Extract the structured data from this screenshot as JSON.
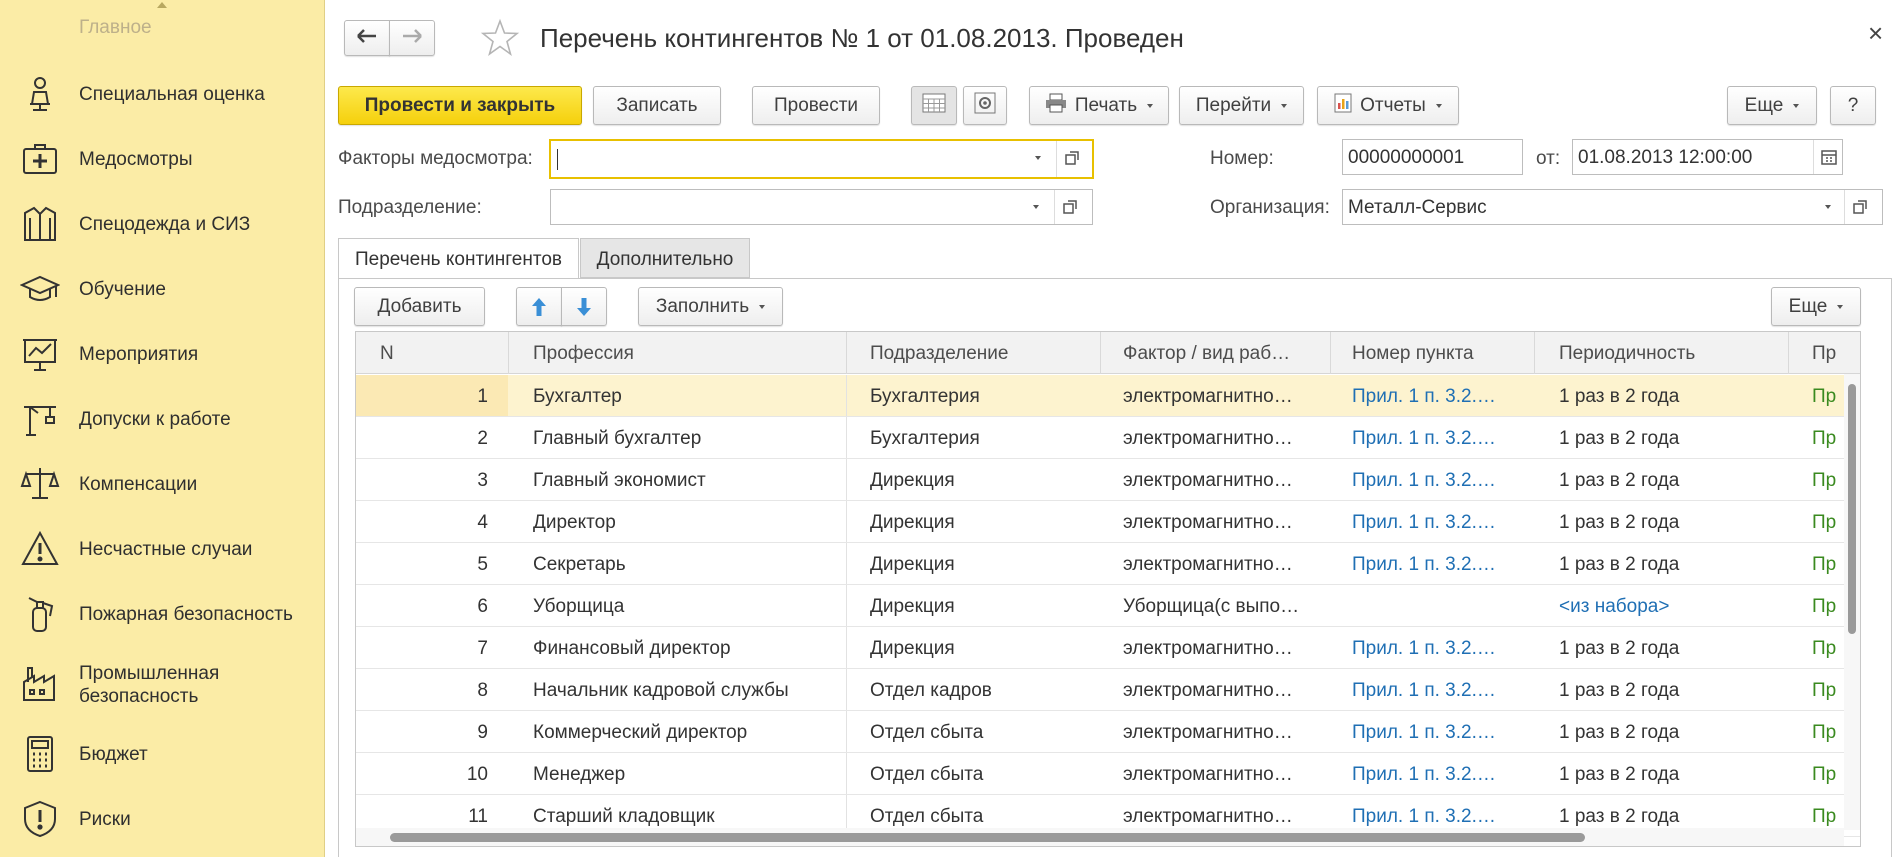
{
  "sidebar": {
    "top_cut_label": "Главное",
    "items": [
      {
        "label": "Специальная оценка",
        "icon": "worker-chair-icon"
      },
      {
        "label": "Медосмотры",
        "icon": "medical-case-icon"
      },
      {
        "label": "Спецодежда и СИЗ",
        "icon": "jacket-icon"
      },
      {
        "label": "Обучение",
        "icon": "graduation-cap-icon"
      },
      {
        "label": "Мероприятия",
        "icon": "presentation-board-icon"
      },
      {
        "label": "Допуски к работе",
        "icon": "crane-icon"
      },
      {
        "label": "Компенсации",
        "icon": "scales-icon"
      },
      {
        "label": "Несчастные случаи",
        "icon": "warning-triangle-icon"
      },
      {
        "label": "Пожарная безопасность",
        "icon": "fire-extinguisher-icon"
      },
      {
        "label": "Промышленная безопасность",
        "icon": "factory-icon"
      },
      {
        "label": "Бюджет",
        "icon": "calculator-icon"
      },
      {
        "label": "Риски",
        "icon": "exclamation-shield-icon"
      }
    ]
  },
  "window": {
    "title": "Перечень контингентов № 1 от 01.08.2013. Проведен",
    "close_glyph": "×"
  },
  "toolbar": {
    "post_close": "Провести и закрыть",
    "save": "Записать",
    "post": "Провести",
    "print": "Печать",
    "goto": "Перейти",
    "reports": "Отчеты",
    "more": "Еще",
    "help": "?"
  },
  "form": {
    "factors_label": "Факторы медосмотра:",
    "factors_value": "",
    "department_label": "Подразделение:",
    "department_value": "",
    "number_label": "Номер:",
    "number_value": "00000000001",
    "date_label": "от:",
    "date_value": "01.08.2013 12:00:00",
    "org_label": "Организация:",
    "org_value": "Металл-Сервис"
  },
  "tabs": [
    "Перечень контингентов",
    "Дополнительно"
  ],
  "table_toolbar": {
    "add": "Добавить",
    "fill": "Заполнить",
    "more": "Еще"
  },
  "table": {
    "columns": [
      "N",
      "Профессия",
      "Подразделение",
      "Фактор / вид раб…",
      "Номер пункта",
      "Периодичность",
      "Пр"
    ],
    "rows": [
      {
        "n": "1",
        "prof": "Бухгалтер",
        "dep": "Бухгалтерия",
        "factor": "электромагнитно…",
        "point": "Прил. 1 п. 3.2.…",
        "period": "1 раз в 2 года",
        "extra": "Пр"
      },
      {
        "n": "2",
        "prof": "Главный бухгалтер",
        "dep": "Бухгалтерия",
        "factor": "электромагнитно…",
        "point": "Прил. 1 п. 3.2.…",
        "period": "1 раз в 2 года",
        "extra": "Пр"
      },
      {
        "n": "3",
        "prof": "Главный экономист",
        "dep": "Дирекция",
        "factor": "электромагнитно…",
        "point": "Прил. 1 п. 3.2.…",
        "period": "1 раз в 2 года",
        "extra": "Пр"
      },
      {
        "n": "4",
        "prof": "Директор",
        "dep": "Дирекция",
        "factor": "электромагнитно…",
        "point": "Прил. 1 п. 3.2.…",
        "period": "1 раз в 2 года",
        "extra": "Пр"
      },
      {
        "n": "5",
        "prof": "Секретарь",
        "dep": "Дирекция",
        "factor": "электромагнитно…",
        "point": "Прил. 1 п. 3.2.…",
        "period": "1 раз в 2 года",
        "extra": "Пр"
      },
      {
        "n": "6",
        "prof": "Уборщица",
        "dep": "Дирекция",
        "factor": "Уборщица(с выпо…",
        "point": "",
        "period": "<из набора>",
        "extra": "Пр"
      },
      {
        "n": "7",
        "prof": "Финансовый директор",
        "dep": "Дирекция",
        "factor": "электромагнитно…",
        "point": "Прил. 1 п. 3.2.…",
        "period": "1 раз в 2 года",
        "extra": "Пр"
      },
      {
        "n": "8",
        "prof": "Начальник кадровой службы",
        "dep": "Отдел кадров",
        "factor": "электромагнитно…",
        "point": "Прил. 1 п. 3.2.…",
        "period": "1 раз в 2 года",
        "extra": "Пр"
      },
      {
        "n": "9",
        "prof": "Коммерческий директор",
        "dep": "Отдел сбыта",
        "factor": "электромагнитно…",
        "point": "Прил. 1 п. 3.2.…",
        "period": "1 раз в 2 года",
        "extra": "Пр"
      },
      {
        "n": "10",
        "prof": "Менеджер",
        "dep": "Отдел сбыта",
        "factor": "электромагнитно…",
        "point": "Прил. 1 п. 3.2.…",
        "period": "1 раз в 2 года",
        "extra": "Пр"
      },
      {
        "n": "11",
        "prof": "Старший кладовщик",
        "dep": "Отдел сбыта",
        "factor": "электромагнитно…",
        "point": "Прил. 1 п. 3.2.…",
        "period": "1 раз в 2 года",
        "extra": "Пр"
      }
    ]
  },
  "colors": {
    "sidebar_bg": "#fbeca6",
    "primary_button": "#f5d00c",
    "link": "#1f6fb4",
    "selected_row": "#fdf3cf",
    "green_text": "#3a8a1f"
  }
}
